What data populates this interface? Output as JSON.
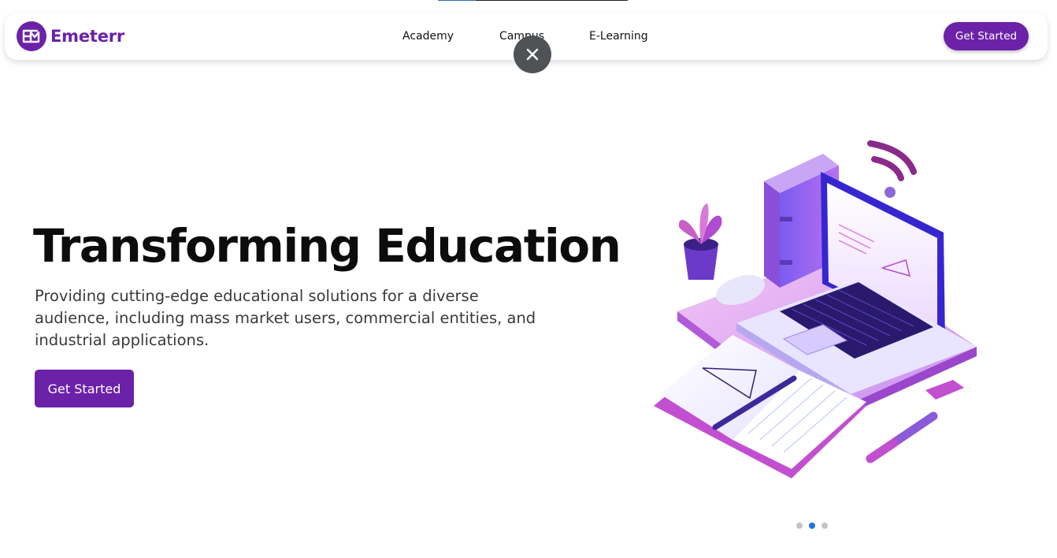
{
  "brand": {
    "name": "Emeterr",
    "logo_icon": "envelope-m-logo-icon",
    "color": "#6b21a8"
  },
  "nav": {
    "links": [
      {
        "label": "Academy"
      },
      {
        "label": "Campus"
      },
      {
        "label": "E-Learning"
      }
    ],
    "cta_label": "Get Started"
  },
  "overlay": {
    "close_icon": "close-icon"
  },
  "hero": {
    "title": "Transforming Education",
    "description": "Providing cutting-edge educational solutions for a diverse audience, including mass market users, commercial entities, and industrial applications.",
    "cta_label": "Get Started",
    "illustration": "isometric-laptop-books-illustration"
  },
  "carousel": {
    "slides": 3,
    "active_index": 1
  },
  "colors": {
    "accent": "#6b21a8",
    "close_bg": "#505356",
    "dot_active": "#1d74e0",
    "dot_inactive": "#c4c4c4"
  }
}
